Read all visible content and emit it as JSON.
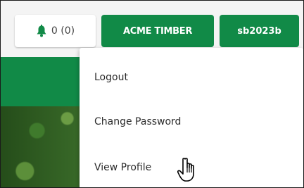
{
  "header": {
    "notifications": {
      "icon": "bell-icon",
      "label": "0 (0)",
      "icon_color": "#118a47"
    },
    "company_button": "ACME TIMBER",
    "user_button": "sb2023b",
    "brand_color": "#118a47"
  },
  "user_menu": {
    "items": [
      {
        "label": "Logout"
      },
      {
        "label": "Change Password"
      },
      {
        "label": "View Profile"
      }
    ]
  },
  "cursor": {
    "icon": "hand-pointer-icon"
  }
}
